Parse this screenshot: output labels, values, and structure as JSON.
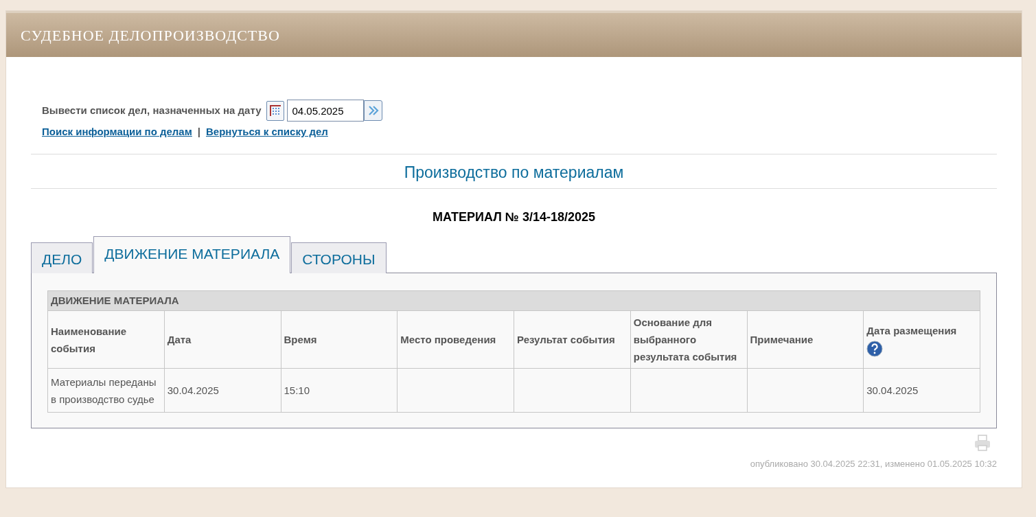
{
  "header": {
    "title": "СУДЕБНОЕ ДЕЛОПРОИЗВОДСТВО"
  },
  "date_filter": {
    "label": "Вывести список дел, назначенных на дату",
    "value": "04.05.2025"
  },
  "links": [
    {
      "text": "Поиск информации по делам"
    },
    {
      "text": "Вернуться к списку дел"
    }
  ],
  "link_separator": "|",
  "section_title": "Производство по материалам",
  "material_title": "МАТЕРИАЛ № 3/14-18/2025",
  "tabs": [
    {
      "label": "ДЕЛО",
      "selected": false
    },
    {
      "label": "ДВИЖЕНИЕ МАТЕРИАЛА",
      "selected": true
    },
    {
      "label": "СТОРОНЫ",
      "selected": false
    }
  ],
  "table": {
    "caption": "ДВИЖЕНИЕ МАТЕРИАЛА",
    "columns": [
      {
        "label": "Наименование события"
      },
      {
        "label": "Дата"
      },
      {
        "label": "Время"
      },
      {
        "label": "Место проведения"
      },
      {
        "label": "Результат события"
      },
      {
        "label": "Основание для выбранного результата события"
      },
      {
        "label": "Примечание"
      },
      {
        "label": "Дата размещения",
        "help": true
      }
    ],
    "rows": [
      [
        "Материалы переданы в производство судье",
        "30.04.2025",
        "15:10",
        "",
        "",
        "",
        "",
        "30.04.2025"
      ]
    ]
  },
  "footer": {
    "published": "опубликовано 30.04.2025 22:31, изменено 01.05.2025 10:32"
  }
}
